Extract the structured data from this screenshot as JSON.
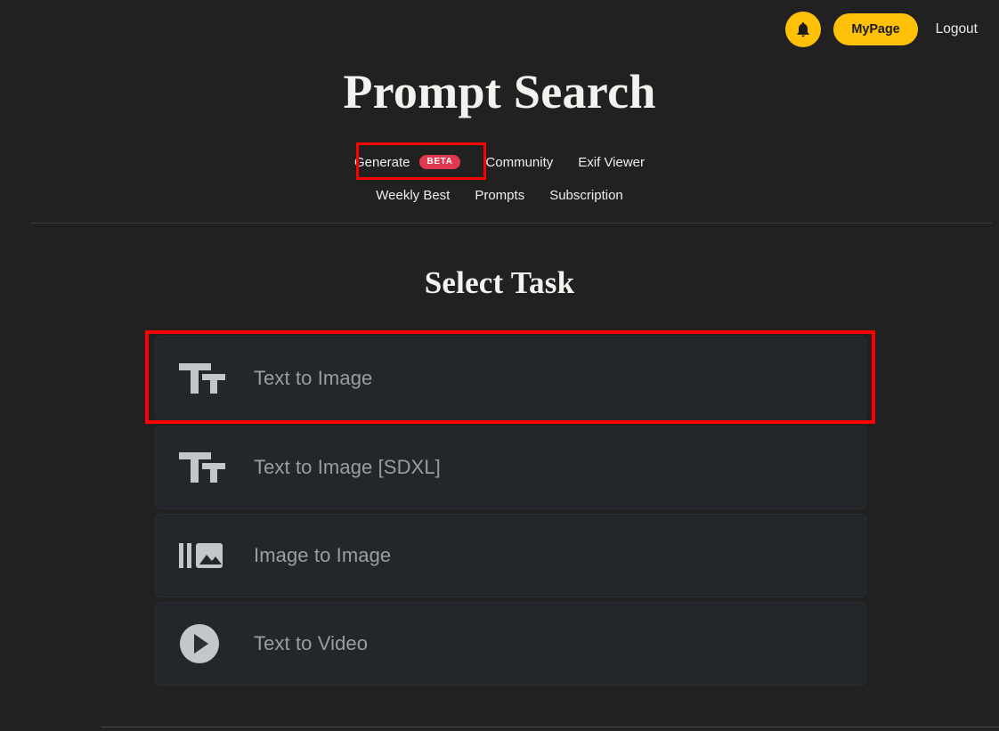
{
  "topbar": {
    "notifications_icon": "bell-icon",
    "mypage_label": "MyPage",
    "logout_label": "Logout",
    "accent_color": "#FFC107"
  },
  "header": {
    "title": "Prompt Search"
  },
  "nav": {
    "row1": [
      {
        "label": "Generate",
        "badge": "BETA",
        "active": true
      },
      {
        "label": "Community",
        "badge": null,
        "active": false
      },
      {
        "label": "Exif Viewer",
        "badge": null,
        "active": false
      }
    ],
    "row2": [
      {
        "label": "Weekly Best"
      },
      {
        "label": "Prompts"
      },
      {
        "label": "Subscription"
      }
    ],
    "badge_color": "#e0394f"
  },
  "main": {
    "section_title": "Select Task",
    "tasks": [
      {
        "label": "Text to Image",
        "icon": "text-icon",
        "highlighted": true
      },
      {
        "label": "Text to Image [SDXL]",
        "icon": "text-icon",
        "highlighted": false
      },
      {
        "label": "Image to Image",
        "icon": "image-icon",
        "highlighted": false
      },
      {
        "label": "Text to Video",
        "icon": "play-icon",
        "highlighted": false
      }
    ]
  },
  "annotations": {
    "highlight_color": "#ff0000"
  }
}
